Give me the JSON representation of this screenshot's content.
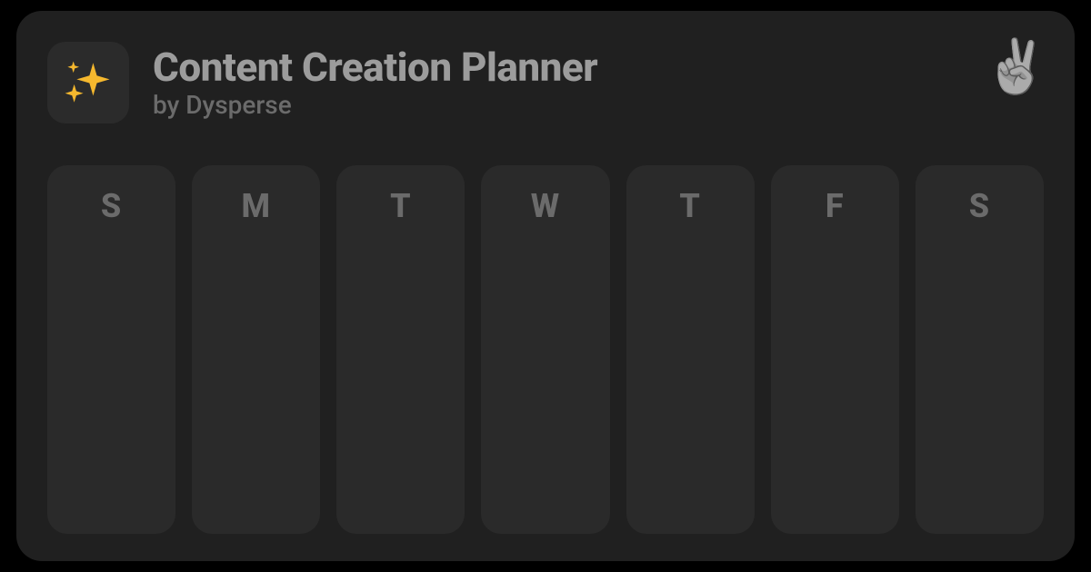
{
  "header": {
    "app_icon": "sparkles-icon",
    "title": "Content Creation Planner",
    "byline": "by Dysperse",
    "corner_icon": "peace-hand-icon",
    "corner_glyph": "✌️"
  },
  "week": {
    "days": [
      {
        "label": "S"
      },
      {
        "label": "M"
      },
      {
        "label": "T"
      },
      {
        "label": "W"
      },
      {
        "label": "T"
      },
      {
        "label": "F"
      },
      {
        "label": "S"
      }
    ]
  },
  "colors": {
    "card_bg": "#202020",
    "tile_bg": "#2a2a2a",
    "title_fg": "#9c9c9c",
    "muted_fg": "#6b6b6b",
    "sparkle": "#f5b82e"
  }
}
